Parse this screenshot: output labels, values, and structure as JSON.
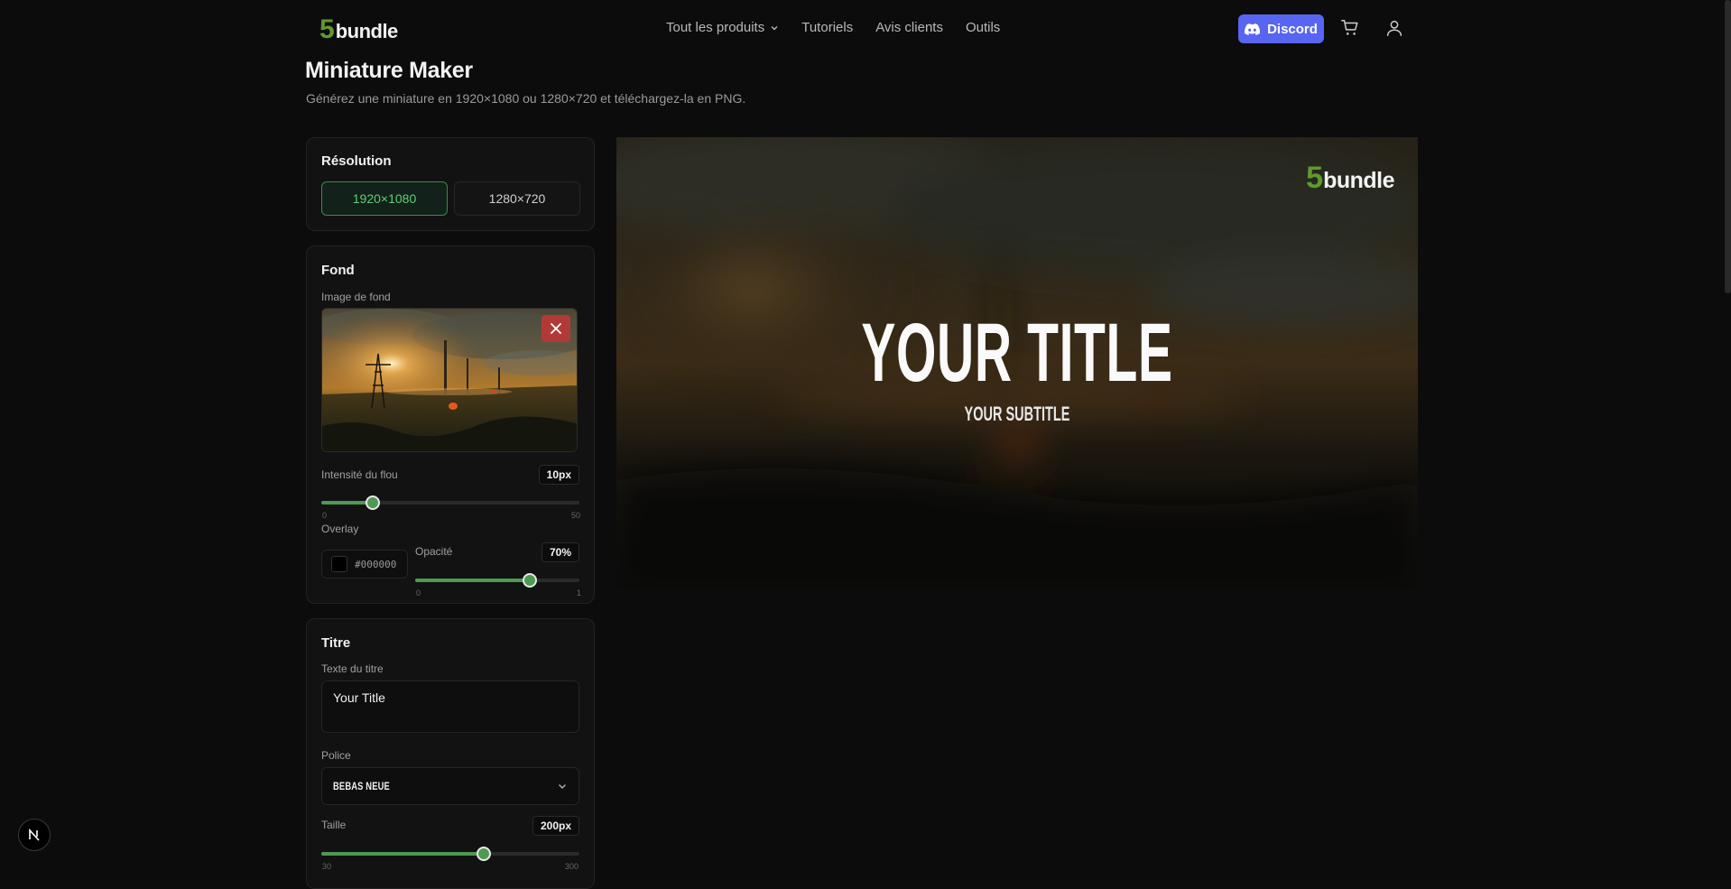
{
  "header": {
    "logo_digit": "5",
    "logo_word": "bundle",
    "nav": [
      "Tout les produits",
      "Tutoriels",
      "Avis clients",
      "Outils"
    ],
    "discord_label": "Discord",
    "icons": [
      "cart-icon",
      "user-icon"
    ]
  },
  "page": {
    "title": "Miniature Maker",
    "subtitle": "Générez une miniature en 1920×1080 ou 1280×720 et téléchargez-la en PNG."
  },
  "resolution": {
    "title": "Résolution",
    "options": [
      "1920×1080",
      "1280×720"
    ],
    "selected": "1920×1080"
  },
  "fond": {
    "title": "Fond",
    "image_label": "Image de fond",
    "blur_label": "Intensité du flou",
    "blur_value": "10px",
    "blur_level": 10,
    "blur_min": "0",
    "blur_max": "50",
    "overlay_label": "Overlay",
    "overlay_color": "#000000",
    "opacity_label": "Opacité",
    "opacity_value": "70%",
    "opacity_level": 0.7,
    "opacity_min": "0",
    "opacity_max": "1"
  },
  "titre": {
    "title": "Titre",
    "text_label": "Texte du titre",
    "text_value": "Your Title",
    "font_label": "Police",
    "font_value": "BEBAS NEUE",
    "size_label": "Taille",
    "size_value": "200px",
    "size_level": 200,
    "size_min": "30",
    "size_max": "300"
  },
  "preview": {
    "logo_digit": "5",
    "logo_word": "bundle",
    "title": "YOUR TITLE",
    "subtitle": "YOUR SUBTITLE"
  },
  "colors": {
    "accent": "#4e9a52",
    "brand_green": "#5f9a2e",
    "discord": "#5865f2",
    "remove": "#b23a36"
  }
}
